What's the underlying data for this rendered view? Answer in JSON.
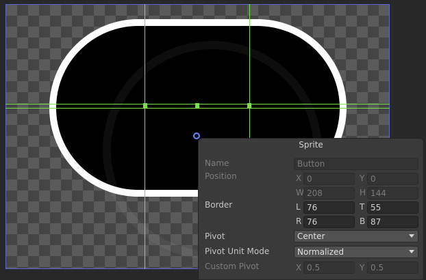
{
  "sprite_editor": {
    "title": "Sprite",
    "name": {
      "label": "Name",
      "value": "Button"
    },
    "position": {
      "label": "Position",
      "x_label": "X",
      "x": "0",
      "y_label": "Y",
      "y": "0",
      "w_label": "W",
      "w": "208",
      "h_label": "H",
      "h": "144"
    },
    "border": {
      "label": "Border",
      "l_label": "L",
      "l": "76",
      "t_label": "T",
      "t": "55",
      "r_label": "R",
      "r": "76",
      "b_label": "B",
      "b": "87"
    },
    "pivot": {
      "label": "Pivot",
      "value": "Center"
    },
    "pivot_unit_mode": {
      "label": "Pivot Unit Mode",
      "value": "Normalized"
    },
    "custom_pivot": {
      "label": "Custom Pivot",
      "x_label": "X",
      "x": "0.5",
      "y_label": "Y",
      "y": "0.5"
    }
  },
  "colors": {
    "guide": "#7ae04a",
    "sprite_outline": "#5c66d6",
    "pivot": "#6c86ff",
    "panel_bg": "#3a3a3a"
  }
}
